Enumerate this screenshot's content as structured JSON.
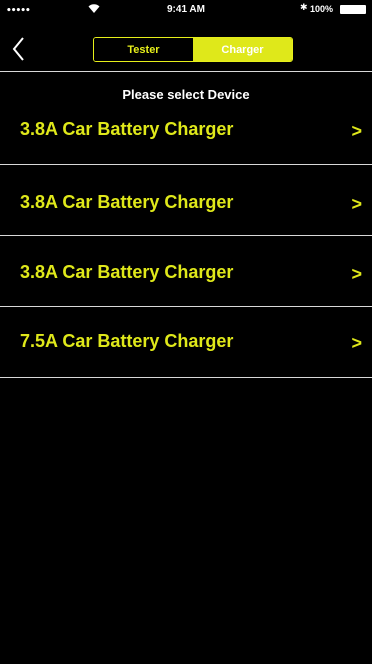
{
  "status_bar": {
    "signal": "•••••",
    "time": "9:41 AM",
    "bluetooth": "✱",
    "battery": "100%"
  },
  "nav": {
    "segments": [
      "Tester",
      "Charger"
    ],
    "active_segment": "Charger"
  },
  "content": {
    "subtitle": "Please select Device",
    "devices": [
      {
        "label": "3.8A Car Battery Charger",
        "chevron": ">"
      },
      {
        "label": "3.8A Car Battery Charger",
        "chevron": ">"
      },
      {
        "label": "3.8A Car Battery Charger",
        "chevron": ">"
      },
      {
        "label": "7.5A Car Battery Charger",
        "chevron": ">"
      }
    ]
  },
  "colors": {
    "accent": "#dfe81a",
    "background": "#000000",
    "divider": "#d8d8d8"
  }
}
